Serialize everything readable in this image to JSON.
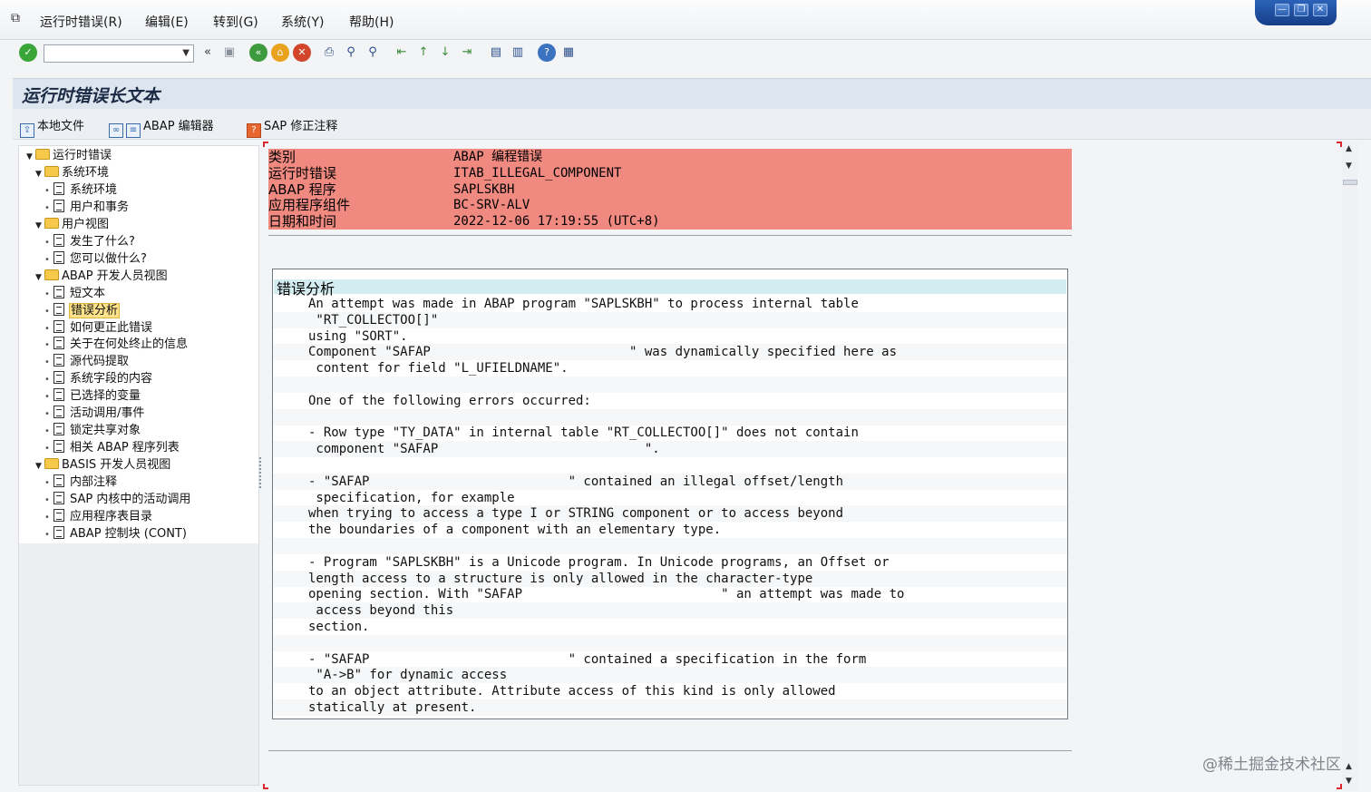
{
  "menu": {
    "items": [
      "运行时错误(R)",
      "编辑(E)",
      "转到(G)",
      "系统(Y)",
      "帮助(H)"
    ]
  },
  "window_controls": {
    "minimize": "—",
    "restore": "❐",
    "close": "✕"
  },
  "toolbar": {
    "command_field_value": "",
    "back_chevron": "«",
    "icons": [
      "check-icon",
      "save-icon",
      "back-icon",
      "exit-icon",
      "cancel-icon",
      "print-icon",
      "find-icon",
      "find-next-icon",
      "first-page-icon",
      "previous-page-icon",
      "next-page-icon",
      "last-page-icon",
      "create-session-icon",
      "shortcut-icon",
      "help-icon",
      "customize-layout-icon"
    ]
  },
  "page": {
    "title": "运行时错误长文本"
  },
  "app_toolbar": {
    "local_file": "本地文件",
    "abap_editor": "ABAP 编辑器",
    "sap_note": "SAP 修正注释"
  },
  "tree": {
    "nodes": [
      {
        "label": "运行时错误",
        "type": "folder",
        "level": 0
      },
      {
        "label": "系统环境",
        "type": "folder",
        "level": 1
      },
      {
        "label": "系统环境",
        "type": "doc",
        "level": 2
      },
      {
        "label": "用户和事务",
        "type": "doc",
        "level": 2
      },
      {
        "label": "用户视图",
        "type": "folder",
        "level": 1
      },
      {
        "label": "发生了什么?",
        "type": "doc",
        "level": 2
      },
      {
        "label": "您可以做什么?",
        "type": "doc",
        "level": 2
      },
      {
        "label": "ABAP 开发人员视图",
        "type": "folder",
        "level": 1
      },
      {
        "label": "短文本",
        "type": "doc",
        "level": 2
      },
      {
        "label": "错误分析",
        "type": "doc",
        "level": 2,
        "selected": true
      },
      {
        "label": "如何更正此错误",
        "type": "doc",
        "level": 2
      },
      {
        "label": "关于在何处终止的信息",
        "type": "doc",
        "level": 2
      },
      {
        "label": "源代码提取",
        "type": "doc",
        "level": 2
      },
      {
        "label": "系统字段的内容",
        "type": "doc",
        "level": 2
      },
      {
        "label": "已选择的变量",
        "type": "doc",
        "level": 2
      },
      {
        "label": "活动调用/事件",
        "type": "doc",
        "level": 2
      },
      {
        "label": "锁定共享对象",
        "type": "doc",
        "level": 2
      },
      {
        "label": "相关 ABAP 程序列表",
        "type": "doc",
        "level": 2
      },
      {
        "label": "BASIS 开发人员视图",
        "type": "folder",
        "level": 1
      },
      {
        "label": "内部注释",
        "type": "doc",
        "level": 2
      },
      {
        "label": "SAP 内核中的活动调用",
        "type": "doc",
        "level": 2
      },
      {
        "label": "应用程序表目录",
        "type": "doc",
        "level": 2
      },
      {
        "label": "ABAP 控制块 (CONT)",
        "type": "doc",
        "level": 2
      }
    ]
  },
  "error_header": {
    "rows": [
      {
        "key": "类别",
        "value": "ABAP 编程错误"
      },
      {
        "key": "运行时错误",
        "value": "ITAB_ILLEGAL_COMPONENT"
      },
      {
        "key": "ABAP 程序",
        "value": "SAPLSKBH"
      },
      {
        "key": "应用程序组件",
        "value": "BC-SRV-ALV"
      },
      {
        "key": "日期和时间",
        "value": "2022-12-06 17:19:55 (UTC+8)"
      }
    ]
  },
  "analysis": {
    "heading": "错误分析",
    "lines": [
      "An attempt was made in ABAP program \"SAPLSKBH\" to process internal table",
      " \"RT_COLLECTOO[]\"",
      "using \"SORT\".",
      "Component \"SAFAP                          \" was dynamically specified here as",
      " content for field \"L_UFIELDNAME\".",
      "",
      "One of the following errors occurred:",
      "",
      "- Row type \"TY_DATA\" in internal table \"RT_COLLECTOO[]\" does not contain",
      " component \"SAFAP                           \".",
      "",
      "- \"SAFAP                          \" contained an illegal offset/length",
      " specification, for example",
      "when trying to access a type I or STRING component or to access beyond",
      "the boundaries of a component with an elementary type.",
      "",
      "- Program \"SAPLSKBH\" is a Unicode program. In Unicode programs, an Offset or",
      "length access to a structure is only allowed in the character-type",
      "opening section. With \"SAFAP                          \" an attempt was made to",
      " access beyond this",
      "section.",
      "",
      "- \"SAFAP                          \" contained a specification in the form",
      " \"A->B\" for dynamic access",
      "to an object attribute. Attribute access of this kind is only allowed",
      "statically at present."
    ]
  },
  "watermark": "@稀土掘金技术社区",
  "colors": {
    "error_header_bg": "#f08a80",
    "section_header_bg": "#d2ecf0",
    "selected_node_bg": "#ffe38a",
    "title_bar_bg": "#dde5ee"
  }
}
